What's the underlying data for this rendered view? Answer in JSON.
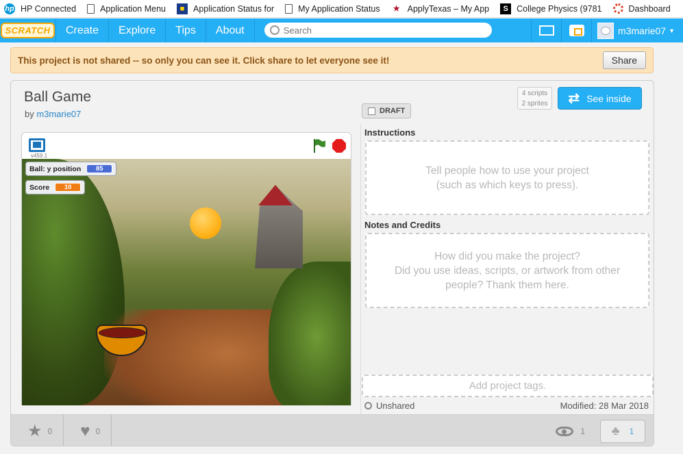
{
  "bookmarks": [
    {
      "icon": "hp-icon",
      "label": "HP Connected"
    },
    {
      "icon": "document-icon",
      "label": "Application Menu"
    },
    {
      "icon": "app-status-icon",
      "label": "Application Status for"
    },
    {
      "icon": "document-icon",
      "label": "My Application Status"
    },
    {
      "icon": "star-icon",
      "label": "ApplyTexas – My App"
    },
    {
      "icon": "s-icon",
      "label": "College Physics (9781"
    },
    {
      "icon": "ring-icon",
      "label": "Dashboard"
    }
  ],
  "nav": {
    "logo": "SCRATCH",
    "links": [
      "Create",
      "Explore",
      "Tips",
      "About"
    ],
    "search_placeholder": "Search",
    "username": "m3marie07"
  },
  "banner": {
    "text": "This project is not shared -- so only you can see it. Click share to let everyone see it!",
    "share_label": "Share"
  },
  "project": {
    "title": "Ball Game",
    "by_prefix": "by",
    "author": "m3marie07",
    "draft_label": "DRAFT",
    "scripts": "4 scripts",
    "sprites": "2 sprites",
    "see_inside_label": "See inside"
  },
  "player": {
    "version": "v459.1",
    "monitors": [
      {
        "label": "Ball: y position",
        "value": "85",
        "color": "#4a6cd4"
      },
      {
        "label": "Score",
        "value": "10",
        "color": "#ee7d16"
      }
    ]
  },
  "instructions": {
    "label": "Instructions",
    "placeholder_line1": "Tell people how to use your project",
    "placeholder_line2": "(such as which keys to press)."
  },
  "notes": {
    "label": "Notes and Credits",
    "placeholder_line1": "How did you make the project?",
    "placeholder_line2": "Did you use ideas, scripts, or artwork from other",
    "placeholder_line3": "people? Thank them here."
  },
  "tags_placeholder": "Add project tags.",
  "status": {
    "unshared": "Unshared",
    "modified": "Modified: 28 Mar 2018"
  },
  "stats": {
    "stars": "0",
    "loves": "0",
    "views": "1",
    "remixes": "1"
  }
}
